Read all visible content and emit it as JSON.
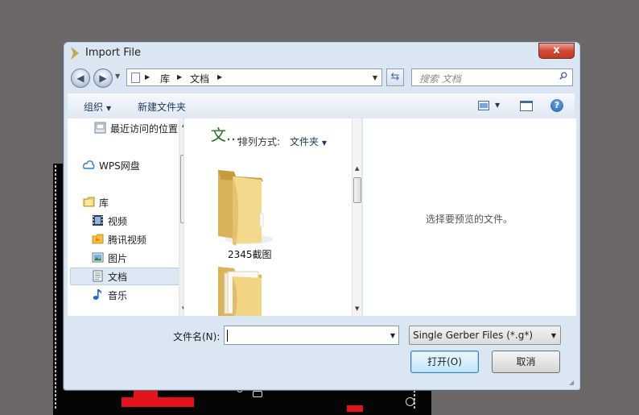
{
  "dialog": {
    "title": "Import File",
    "close_label": "x"
  },
  "address": {
    "crumbs": [
      "库",
      "文档"
    ],
    "search_placeholder": "搜索 文档"
  },
  "toolbar": {
    "organize": "组织",
    "new_folder": "新建文件夹"
  },
  "nav": {
    "items": [
      {
        "label": "最近访问的位置",
        "icon": "recent-places-icon"
      },
      {
        "label": "WPS网盘",
        "icon": "cloud-icon"
      },
      {
        "label": "库",
        "icon": "library-icon"
      },
      {
        "label": "视频",
        "icon": "video-icon"
      },
      {
        "label": "腾讯视频",
        "icon": "tencent-video-icon"
      },
      {
        "label": "图片",
        "icon": "pictures-icon"
      },
      {
        "label": "文档",
        "icon": "documents-icon",
        "selected": true
      },
      {
        "label": "音乐",
        "icon": "music-icon"
      }
    ]
  },
  "files": {
    "library_title": "文...",
    "arrange_label": "排列方式:",
    "arrange_value": "文件夹",
    "items": [
      {
        "name": "2345截图"
      },
      {
        "name": ""
      }
    ]
  },
  "preview": {
    "empty_text": "选择要预览的文件。"
  },
  "bottom": {
    "filename_label": "文件名(N):",
    "filename_value": "",
    "filter_value": "Single Gerber Files (*.g*)",
    "open_label": "打开(O)",
    "cancel_label": "取消"
  },
  "colors": {
    "dialog_frame": "#dbe6f3",
    "accent": "#1e395b",
    "close": "#c23b25",
    "pcb_trace": "#e2131a"
  }
}
